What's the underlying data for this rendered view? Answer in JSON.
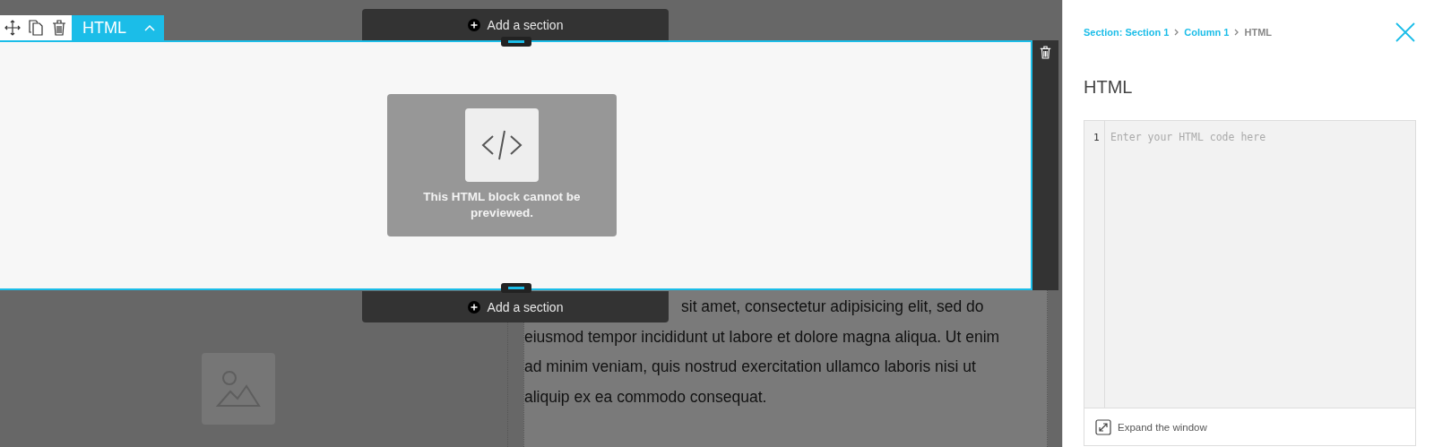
{
  "block_toolbar": {
    "label": "HTML",
    "tools": [
      {
        "kind": "move"
      },
      {
        "kind": "copy"
      },
      {
        "kind": "delete"
      }
    ]
  },
  "add_section_top": {
    "label": "Add a section"
  },
  "html_block": {
    "message": "This HTML block cannot be previewed."
  },
  "add_section_bottom": {
    "label": "Add a section"
  },
  "text_column": {
    "lines": [
      "sit amet, consectetur adipisicing elit, sed do",
      "eiusmod tempor incididunt ut labore et dolore magna aliqua. Ut enim",
      "ad minim veniam, quis nostrud exercitation ullamco laboris nisi ut",
      "aliquip ex ea commodo consequat."
    ]
  },
  "panel": {
    "breadcrumb": [
      {
        "label": "Section: Section 1",
        "link": true
      },
      {
        "label": "Column 1",
        "link": true
      },
      {
        "label": "HTML",
        "link": false
      }
    ],
    "title": "HTML",
    "editor": {
      "line_numbers": [
        "1"
      ],
      "placeholder": "Enter your HTML code here"
    },
    "expand_button": "Expand the window"
  }
}
